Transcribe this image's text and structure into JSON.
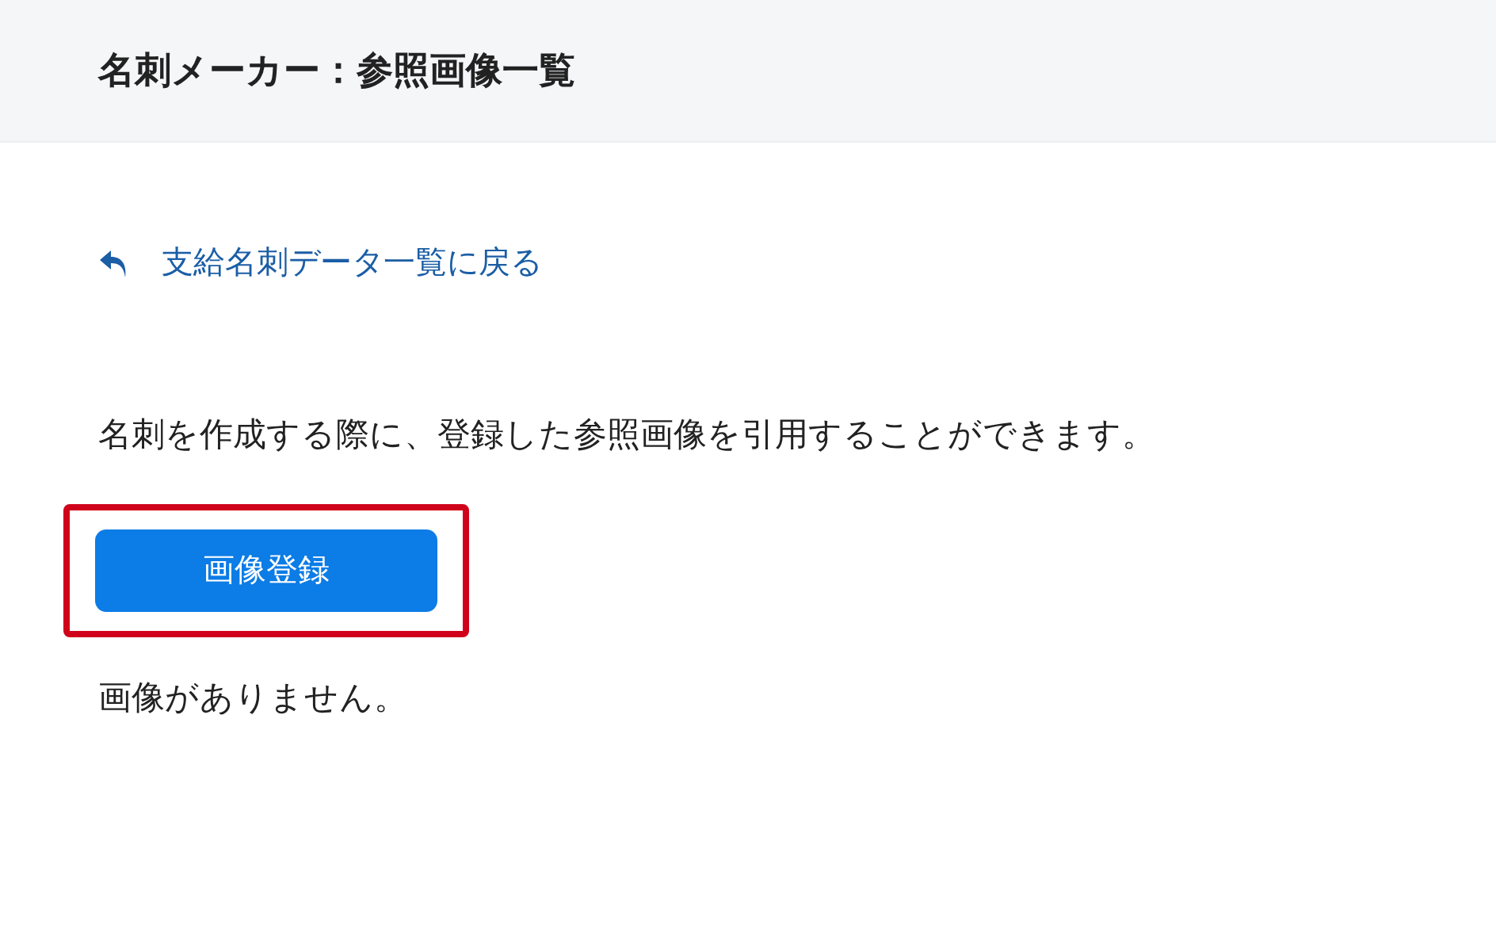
{
  "header": {
    "title": "名刺メーカー：参照画像一覧"
  },
  "back_link": {
    "label": "支給名刺データ一覧に戻る"
  },
  "description": "名刺を作成する際に、登録した参照画像を引用することができます。",
  "register_button": {
    "label": "画像登録",
    "highlighted": true
  },
  "empty_message": "画像がありません。"
}
